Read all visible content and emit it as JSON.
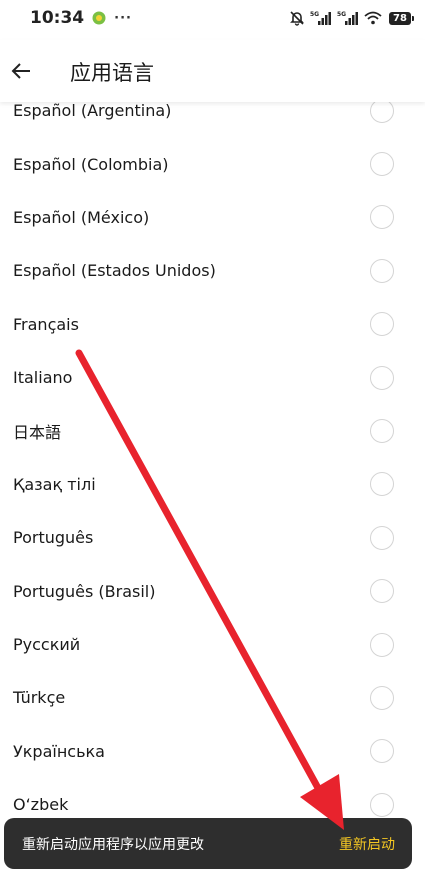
{
  "status_bar": {
    "time": "10:34",
    "more": "···",
    "battery": "78"
  },
  "header": {
    "title": "应用语言"
  },
  "languages": [
    {
      "label": "Español (Argentina)"
    },
    {
      "label": "Español (Colombia)"
    },
    {
      "label": "Español (México)"
    },
    {
      "label": "Español (Estados Unidos)"
    },
    {
      "label": "Français"
    },
    {
      "label": "Italiano"
    },
    {
      "label": "日本語"
    },
    {
      "label": "Қазақ тілі"
    },
    {
      "label": "Português"
    },
    {
      "label": "Português (Brasil)"
    },
    {
      "label": "Русский"
    },
    {
      "label": "Türkçe"
    },
    {
      "label": "Українська"
    },
    {
      "label": "O‘zbek"
    }
  ],
  "snackbar": {
    "message": "重新启动应用程序以应用更改",
    "action": "重新启动"
  },
  "colors": {
    "snackbar_bg": "#2e2e2e",
    "snackbar_action": "#f3c623",
    "annotation_arrow": "#e8232d"
  }
}
